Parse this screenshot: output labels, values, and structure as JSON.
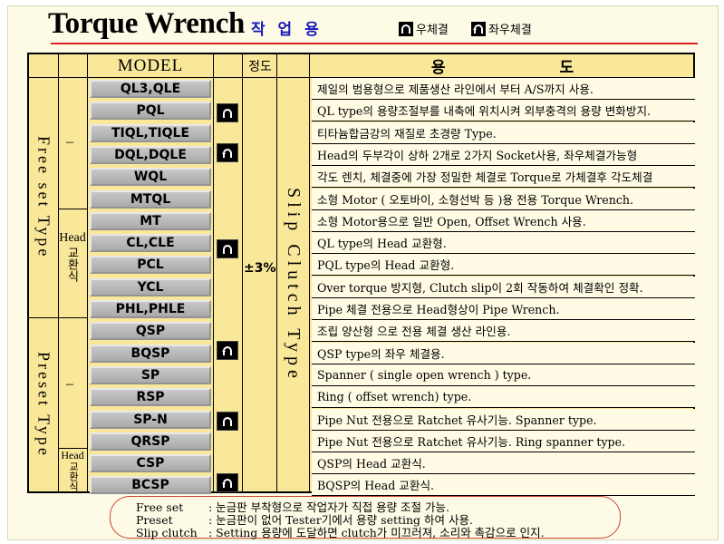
{
  "header": {
    "title": "Torque Wrench",
    "subtitle": "작 업 용",
    "legend": [
      {
        "icon": "right-tighten-icon",
        "label": "우체결"
      },
      {
        "icon": "both-tighten-icon",
        "label": "좌우체결"
      }
    ]
  },
  "table": {
    "headers": {
      "model": "MODEL",
      "accuracy": "정도",
      "use": "용 도"
    },
    "groups": {
      "free_set": "Free set Type",
      "preset": "Preset Type",
      "slip_clutch": "Slip Clutch Type",
      "dash": "–",
      "head_label": "Head",
      "head_sub": "교환식",
      "accuracy": "±3%"
    },
    "rows": [
      {
        "model": "QL3,QLE",
        "use": "제일의 범용형으로 제품생산 라인에서 부터 A/S까지 사용."
      },
      {
        "model": "PQL",
        "use": "QL type의 용량조절부를 내축에 위치시켜 외부충격의 용량 변화방지."
      },
      {
        "model": "TIQL,TIQLE",
        "use": "티타늄합금강의 재질로 초경량 Type."
      },
      {
        "model": "DQL,DQLE",
        "use": "Head의 두부각이 상하 2개로 2가지 Socket사용, 좌우체결가능형"
      },
      {
        "model": "WQL",
        "use": "각도 렌치, 체결중에 가장 정밀한 체결로 Torque로 가체결후 각도체결"
      },
      {
        "model": "MTQL",
        "use": "소형 Motor ( 오토바이, 소형선박 등 )용 전용  Torque Wrench."
      },
      {
        "model": "MT",
        "use": "소형  Motor용으로 일반 Open, Offset Wrench 사용."
      },
      {
        "model": "CL,CLE",
        "use": "QL type의  Head 교환형."
      },
      {
        "model": "PCL",
        "use": "PQL type의  Head 교환형."
      },
      {
        "model": "YCL",
        "use": "Over torque 방지형,  Clutch slip이 2회 작동하여 체결확인 정확."
      },
      {
        "model": "PHL,PHLE",
        "use": "Pipe 체결 전용으로  Head형상이 Pipe Wrench."
      },
      {
        "model": "QSP",
        "use": "조립 양산형 으로  전용 체결 생산 라인용."
      },
      {
        "model": "BQSP",
        "use": "QSP type의 좌우 체결용."
      },
      {
        "model": "SP",
        "use": "Spanner ( single open wrench ) type."
      },
      {
        "model": "RSP",
        "use": "Ring     ( offset wrench)   type."
      },
      {
        "model": "SP-N",
        "use": "Pipe Nut 전용으로  Ratchet 유사기능.  Spanner type."
      },
      {
        "model": "QRSP",
        "use": "Pipe Nut 전용으로  Ratchet 유사기능.  Ring spanner type."
      },
      {
        "model": "CSP",
        "use": "QSP의 Head 교환식."
      },
      {
        "model": "BCSP",
        "use": "BQSP의 Head 교환식."
      }
    ]
  },
  "notes": [
    {
      "key": "Free set",
      "text": ": 눈금판 부착형으로 작업자가 직접 용량 조절 가능."
    },
    {
      "key": "Preset",
      "text": ": 눈금판이 없어  Tester기에서  용량 setting 하여 사용."
    },
    {
      "key": "Slip clutch",
      "text": ": Setting 용량에 도달하면 clutch가 미끄러져, 소리와 촉감으로 인지."
    }
  ]
}
